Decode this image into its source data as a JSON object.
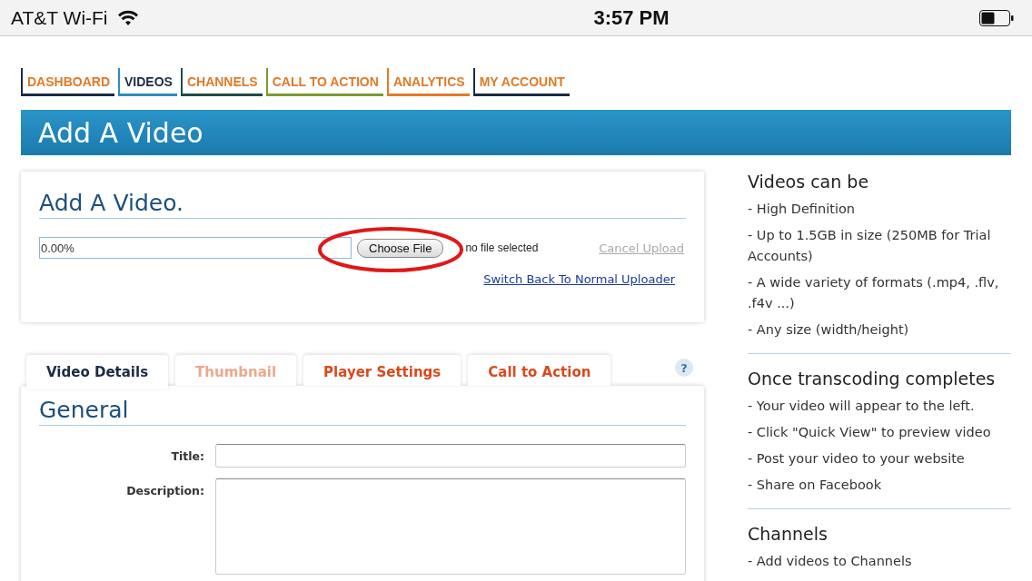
{
  "status_bar": {
    "carrier": "AT&T Wi-Fi",
    "time": "3:57 PM"
  },
  "nav_tabs": [
    {
      "label": "DASHBOARD",
      "selected": false,
      "color": "#1c2b45"
    },
    {
      "label": "VIDEOS",
      "selected": true,
      "color": "#2b8ec0"
    },
    {
      "label": "CHANNELS",
      "selected": false,
      "color": "#1f4c45"
    },
    {
      "label": "CALL TO ACTION",
      "selected": false,
      "color": "#7c9a2e"
    },
    {
      "label": "ANALYTICS",
      "selected": false,
      "color": "#e47a2a"
    },
    {
      "label": "MY ACCOUNT",
      "selected": false,
      "color": "#1c2b45"
    }
  ],
  "banner": {
    "title": "Add A Video"
  },
  "upload": {
    "heading": "Add A Video.",
    "progress": "0.00%",
    "choose_button": "Choose File",
    "file_status": "no file selected",
    "cancel_link": "Cancel Upload",
    "cancel_disabled": true,
    "switch_link": "Switch Back To Normal Uploader",
    "annotation_circle": true
  },
  "detail_tabs": [
    {
      "label": "Video Details",
      "selected": true,
      "disabled": false
    },
    {
      "label": "Thumbnail",
      "selected": false,
      "disabled": true
    },
    {
      "label": "Player Settings",
      "selected": false,
      "disabled": false
    },
    {
      "label": "Call to Action",
      "selected": false,
      "disabled": false
    }
  ],
  "help": "?",
  "general": {
    "heading": "General",
    "fields": [
      {
        "label": "Title:",
        "kind": "input"
      },
      {
        "label": "Description:",
        "kind": "textarea"
      }
    ]
  },
  "sidebar": [
    {
      "heading": "Videos can be",
      "items": [
        "- High Definition",
        "- Up to 1.5GB in size (250MB for Trial Accounts)",
        "- A wide variety of formats (.mp4, .flv, .f4v ...)",
        "- Any size (width/height)"
      ]
    },
    {
      "heading": "Once transcoding completes",
      "items": [
        "- Your video will appear to the left.",
        "- Click \"Quick View\" to preview video",
        "- Post your video to your website",
        "- Share on Facebook"
      ]
    },
    {
      "heading": "Channels",
      "items": [
        "- Add videos to Channels"
      ]
    }
  ]
}
